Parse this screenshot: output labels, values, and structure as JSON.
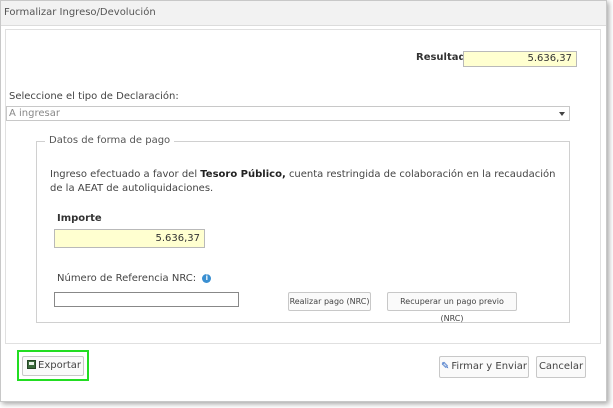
{
  "window": {
    "title": "Formalizar Ingreso/Devolución"
  },
  "resultado": {
    "label": "Resultado",
    "value": "5.636,37"
  },
  "declaracion": {
    "label": "Seleccione el tipo de Declaración:",
    "selected": "A ingresar"
  },
  "forma_pago": {
    "legend": "Datos de forma de pago",
    "text_prefix": "Ingreso efectuado a favor del",
    "text_bold": "Tesoro Público,",
    "text_suffix": "cuenta restringida de colaboración en la recaudación de la AEAT de autoliquidaciones.",
    "importe_label": "Importe",
    "importe_value": "5.636,37",
    "nrc_label": "Número de Referencia NRC:",
    "nrc_value": "",
    "btn_realizar": "Realizar pago (NRC)",
    "btn_recuperar": "Recuperar un pago previo (NRC)"
  },
  "footer": {
    "exportar": "Exportar",
    "firmar": "Firmar y Enviar",
    "cancelar": "Cancelar"
  },
  "colors": {
    "highlight": "#22dd22",
    "yellow_field": "#ffffd0",
    "info": "#3a8fd1"
  },
  "icons": {
    "info": "info-icon",
    "export": "export-icon",
    "sign": "sign-icon"
  }
}
